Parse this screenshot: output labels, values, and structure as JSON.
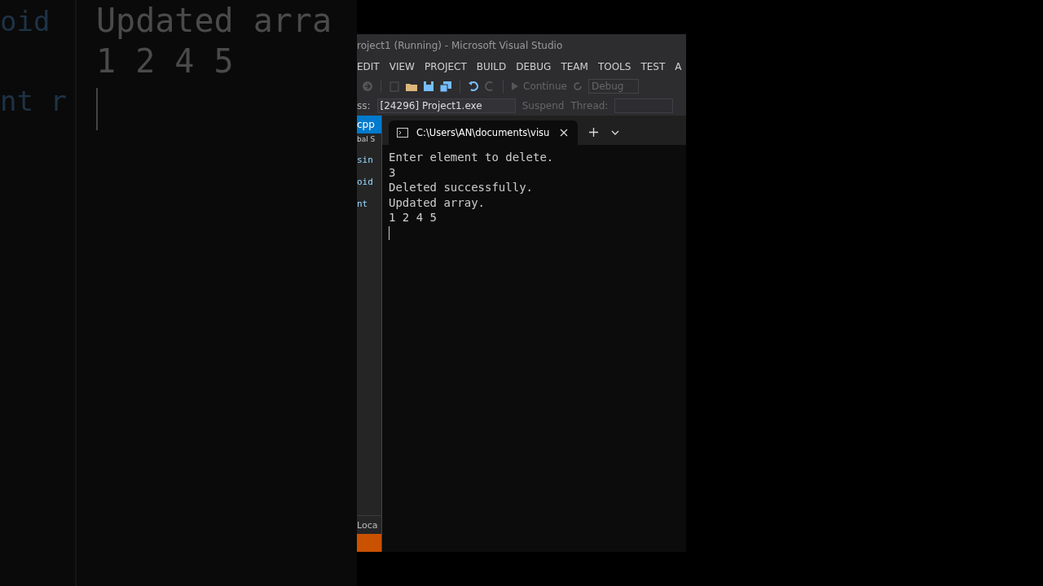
{
  "background_zoom": {
    "code_fragments": [
      "oid",
      "nt r"
    ],
    "console_lines": [
      "Updated arra",
      "1 2 4 5"
    ]
  },
  "visual_studio": {
    "title": "roject1 (Running) - Microsoft Visual Studio",
    "menu": [
      "EDIT",
      "VIEW",
      "PROJECT",
      "BUILD",
      "DEBUG",
      "TEAM",
      "TOOLS",
      "TEST",
      "A"
    ],
    "toolbar": {
      "continue": "Continue",
      "configuration": "Debug"
    },
    "process_label": "ss:",
    "process": "[24296] Project1.exe",
    "suspend": "Suspend",
    "thread_label": "Thread:",
    "editor_tab": "cpp",
    "sidebar_fragments": [
      "bal S",
      "sin",
      "oid",
      "nt"
    ],
    "bottom_tab": "Loca"
  },
  "terminal": {
    "tab_title": "C:\\Users\\AN\\documents\\visu",
    "lines": [
      "Enter element to delete.",
      "3",
      "Deleted successfully.",
      "Updated array.",
      "1 2 4 5"
    ]
  }
}
